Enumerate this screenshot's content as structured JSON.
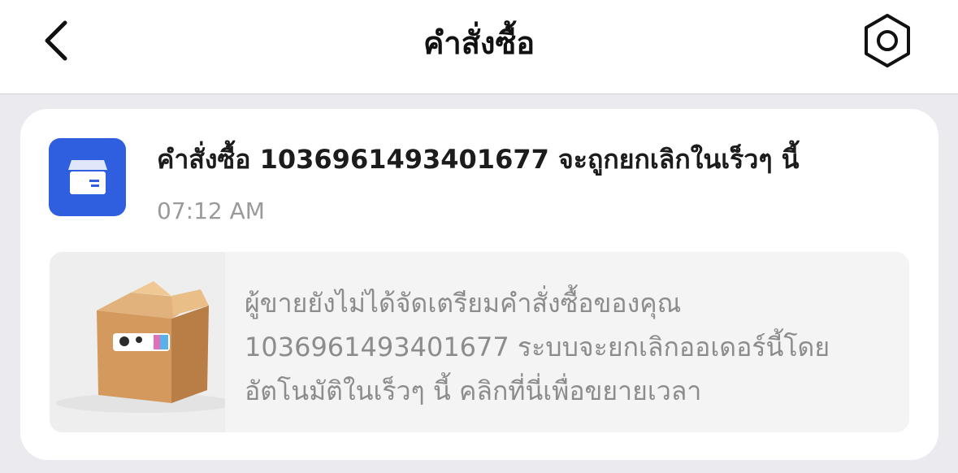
{
  "header": {
    "title": "คำสั่งซื้อ",
    "back_icon": "chevron-left-icon",
    "settings_icon": "hexagon-settings-icon"
  },
  "notification": {
    "icon": "package-icon",
    "accent_color": "#2f5fde",
    "title": "คำสั่งซื้อ 1036961493401677 จะถูกยกเลิกในเร็วๆ นี้",
    "time": "07:12 AM",
    "thumbnail": "cardboard-box-image",
    "message": "ผู้ขายยังไม่ได้จัดเตรียมคำสั่งซื้อของคุณ\n1036961493401677 ระบบจะยกเลิกออเดอร์นี้โดย\nอัตโนมัติในเร็วๆ นี้ คลิกที่นี่เพื่อขยายเวลา"
  }
}
